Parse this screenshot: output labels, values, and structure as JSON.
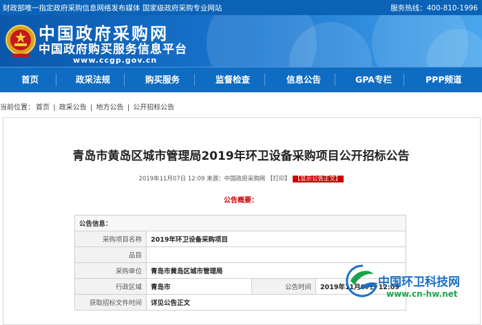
{
  "topbar": {
    "left_text": "财政部唯一指定政府采购信息网络发布媒体 国家级政府采购专业网站",
    "hotline_label": "服务热线：",
    "hotline_number": "400-810-1996"
  },
  "header": {
    "logo_line1": "中国政府采购网",
    "logo_line2": "中国政府购买服务信息平台",
    "logo_url": "www.ccgp.gov.cn"
  },
  "nav": {
    "items": [
      {
        "label": "首页"
      },
      {
        "label": "政采法规"
      },
      {
        "label": "购买服务"
      },
      {
        "label": "监督检查"
      },
      {
        "label": "信息公告"
      },
      {
        "label": "GPA专栏"
      },
      {
        "label": "PPP频道"
      }
    ]
  },
  "breadcrumb": {
    "prefix": "当前位置：",
    "items": [
      "首页",
      "政采公告",
      "地方公告",
      "公开招标公告"
    ],
    "separator": "|"
  },
  "article": {
    "title": "青岛市黄岛区城市管理局2019年环卫设备采购项目公开招标公告",
    "date": "2019年11月07日 12:09",
    "source_label": "来源：",
    "source": "中国政府采购网",
    "print_label": "【打印】",
    "show_body_label": "【显示公告正文】",
    "summary_label": "公告概要："
  },
  "info_table": {
    "header": "公告信息：",
    "rows": [
      {
        "label": "采购项目名称",
        "value": "2019年环卫设备采购项目"
      },
      {
        "label": "品目",
        "value": ""
      },
      {
        "label": "采购单位",
        "value": "青岛市黄岛区城市管理局"
      },
      {
        "label": "行政区域",
        "value": "青岛市",
        "label2": "公告时间",
        "value2": "2019年11月07日 12:09"
      },
      {
        "label": "获取招标文件时间",
        "value": "详见公告正文"
      }
    ]
  },
  "watermark": {
    "name": "中国环卫科技网",
    "url": "www.cn-hw.net"
  },
  "colors": {
    "topbar": "#0b62b7",
    "nav": "#0f6cc3",
    "accent_red": "#cc0000",
    "watermark_blue": "#1a6fc4",
    "watermark_green": "#1aa34a"
  }
}
